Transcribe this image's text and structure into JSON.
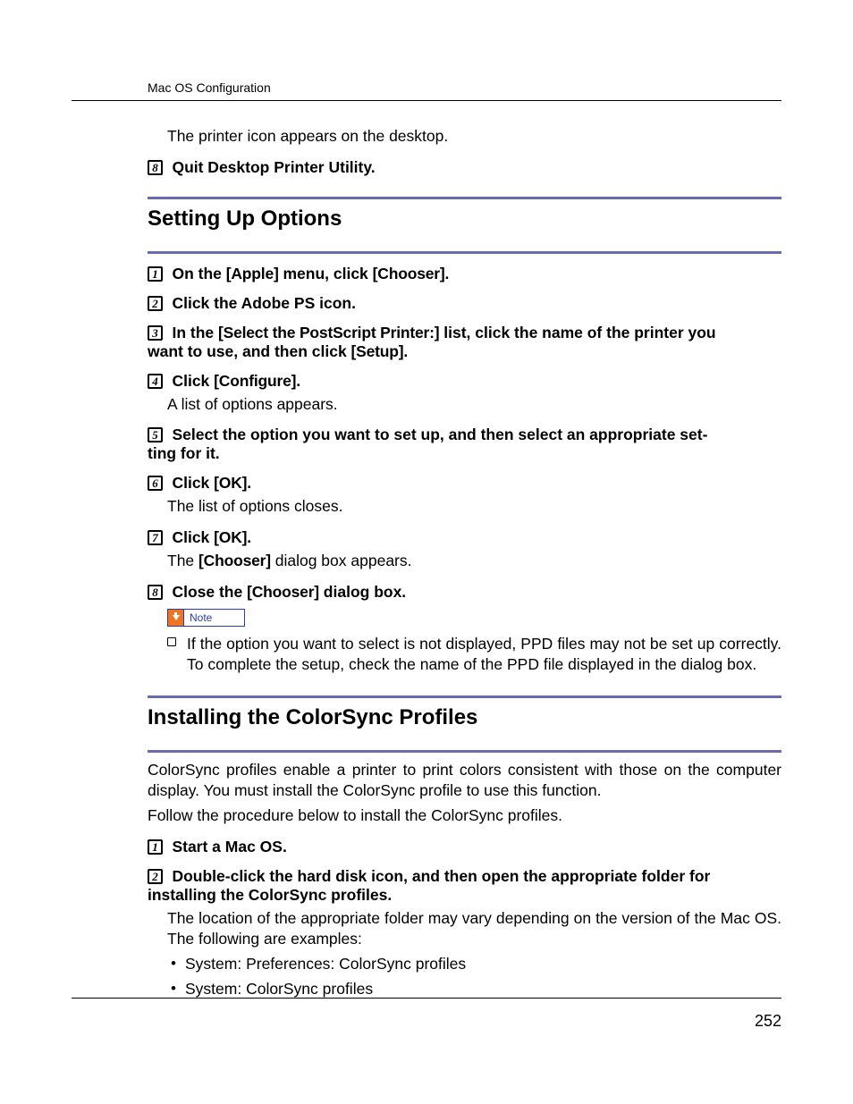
{
  "running_header": "Mac OS Configuration",
  "intro_text": "The printer icon appears on the desktop.",
  "quit_step": {
    "num": "8",
    "text": "Quit Desktop Printer Utility."
  },
  "section1_title": "Setting Up Options",
  "s1": {
    "step1": {
      "num": "1",
      "pre": "On the ",
      "ui1": "[Apple]",
      "mid": " menu, click ",
      "ui2": "[Chooser]",
      "post": "."
    },
    "step2": {
      "num": "2",
      "text": "Click the Adobe PS icon."
    },
    "step3": {
      "num": "3",
      "pre": "In the ",
      "ui1": "[Select the PostScript Printer:]",
      "mid": " list, click the name of the printer you",
      "cont": "want to use, and then click ",
      "ui2": "[Setup]",
      "post": "."
    },
    "step4": {
      "num": "4",
      "pre": "Click ",
      "ui1": "[Configure]",
      "post": ".",
      "body": "A list of options appears."
    },
    "step5": {
      "num": "5",
      "line1": "Select the option you want to set up, and then select an appropriate set-",
      "line2": "ting for it."
    },
    "step6": {
      "num": "6",
      "pre": "Click ",
      "ui1": "[OK]",
      "post": ".",
      "body": "The list of options closes."
    },
    "step7": {
      "num": "7",
      "pre": "Click ",
      "ui1": "[OK]",
      "post": ".",
      "body_pre": "The ",
      "body_ui": "[Chooser]",
      "body_post": " dialog box appears."
    },
    "step8": {
      "num": "8",
      "pre": "Close the ",
      "ui1": "[Chooser]",
      "post": " dialog box."
    },
    "note_label": "Note",
    "note_text": "If the option you want to select is not displayed, PPD files may not be set up correctly. To complete the setup, check the name of the PPD file displayed in the dialog box."
  },
  "section2_title": "Installing the ColorSync Profiles",
  "s2": {
    "para1": "ColorSync profiles enable a printer to print colors consistent with those on the computer display. You must install the ColorSync profile to use this function.",
    "para2": "Follow the procedure below to install the ColorSync profiles.",
    "step1": {
      "num": "1",
      "text": "Start a Mac OS."
    },
    "step2": {
      "num": "2",
      "line1": "Double-click the hard disk icon, and then open the appropriate folder for",
      "line2": "installing the ColorSync profiles.",
      "body": "The location of the appropriate folder may vary depending on the version of the Mac OS. The following are examples:"
    },
    "bullet1": "System: Preferences: ColorSync profiles",
    "bullet2": "System: ColorSync profiles"
  },
  "page_number": "252"
}
